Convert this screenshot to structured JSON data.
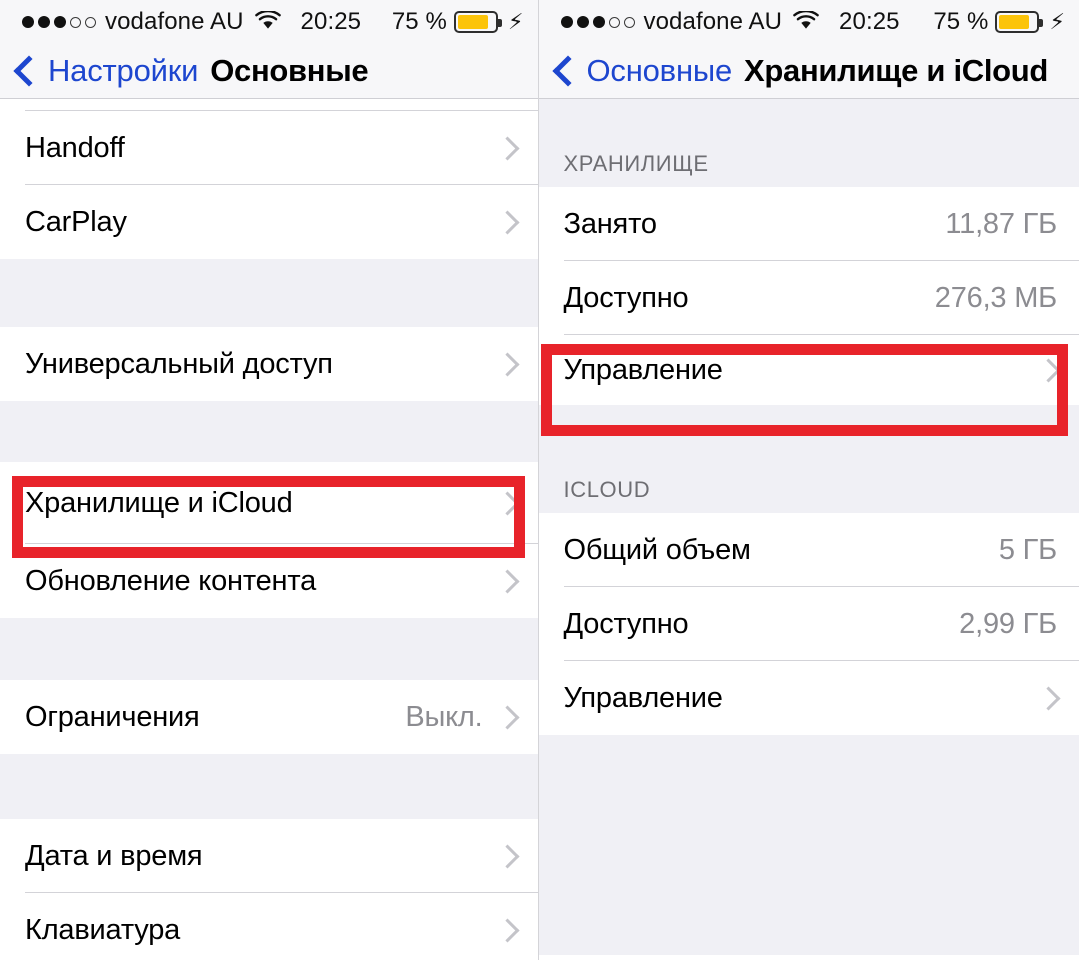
{
  "status_bar": {
    "signal_dots_filled": 3,
    "signal_dots_empty": 2,
    "carrier": "vodafone AU",
    "wifi_icon": "wifi-icon",
    "time": "20:25",
    "battery_percent": "75 %",
    "battery_level": 75,
    "battery_color": "#fcc40a",
    "charging_icon": "lightning-bolt-icon"
  },
  "left_screen": {
    "nav": {
      "back_label": "Настройки",
      "title": "Основные",
      "back_icon": "chevron-left-icon"
    },
    "sections": [
      {
        "rows": [
          {
            "label": "Handoff",
            "value": "",
            "chevron": true
          },
          {
            "label": "CarPlay",
            "value": "",
            "chevron": true
          }
        ]
      },
      {
        "rows": [
          {
            "label": "Универсальный доступ",
            "value": "",
            "chevron": true
          }
        ]
      },
      {
        "rows": [
          {
            "label": "Хранилище и iCloud",
            "value": "",
            "chevron": true,
            "highlighted": true
          },
          {
            "label": "Обновление контента",
            "value": "",
            "chevron": true
          }
        ]
      },
      {
        "rows": [
          {
            "label": "Ограничения",
            "value": "Выкл.",
            "chevron": true
          }
        ]
      },
      {
        "rows": [
          {
            "label": "Дата и время",
            "value": "",
            "chevron": true
          },
          {
            "label": "Клавиатура",
            "value": "",
            "chevron": true
          }
        ]
      }
    ]
  },
  "right_screen": {
    "nav": {
      "back_label": "Основные",
      "title": "Хранилище и iCloud",
      "back_icon": "chevron-left-icon"
    },
    "sections": [
      {
        "header": "ХРАНИЛИЩЕ",
        "rows": [
          {
            "label": "Занято",
            "value": "11,87 ГБ",
            "chevron": false
          },
          {
            "label": "Доступно",
            "value": "276,3 МБ",
            "chevron": false
          },
          {
            "label": "Управление",
            "value": "",
            "chevron": true,
            "highlighted": true
          }
        ]
      },
      {
        "header": "ICLOUD",
        "rows": [
          {
            "label": "Общий объем",
            "value": "5 ГБ",
            "chevron": false
          },
          {
            "label": "Доступно",
            "value": "2,99 ГБ",
            "chevron": false
          },
          {
            "label": "Управление",
            "value": "",
            "chevron": true
          }
        ]
      }
    ]
  },
  "annotations": {
    "highlight_color": "#e8232a",
    "accent_blue": "#1d46cf"
  }
}
